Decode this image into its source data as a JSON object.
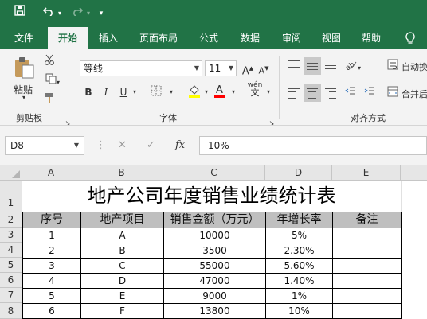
{
  "quick_access": {
    "more_label": "▾"
  },
  "tabs": [
    "文件",
    "开始",
    "插入",
    "页面布局",
    "公式",
    "数据",
    "审阅",
    "视图",
    "帮助"
  ],
  "ribbon": {
    "paste_label": "粘贴",
    "clipboard_group": "剪贴板",
    "font_name": "等线",
    "font_size": "11",
    "font_group": "字体",
    "bold": "B",
    "italic": "I",
    "underline": "U",
    "phonetic": "wén",
    "wrap_text": "自动换",
    "merge_center": "合并后",
    "align_group": "对齐方式"
  },
  "formula_bar": {
    "name_box": "D8",
    "fx": "fx",
    "value": "10%"
  },
  "sheet": {
    "columns": [
      "A",
      "B",
      "C",
      "D",
      "E"
    ],
    "rows": [
      "1",
      "2",
      "3",
      "4",
      "5",
      "6",
      "7",
      "8"
    ],
    "title": "地产公司年度销售业绩统计表",
    "headers": [
      "序号",
      "地产项目",
      "销售金额（万元）",
      "年增长率",
      "备注"
    ],
    "data": [
      [
        "1",
        "A",
        "10000",
        "5%",
        ""
      ],
      [
        "2",
        "B",
        "3500",
        "2.30%",
        ""
      ],
      [
        "3",
        "C",
        "55000",
        "5.60%",
        ""
      ],
      [
        "4",
        "D",
        "47000",
        "1.40%",
        ""
      ],
      [
        "5",
        "E",
        "9000",
        "1%",
        ""
      ],
      [
        "6",
        "F",
        "13800",
        "10%",
        ""
      ]
    ]
  },
  "colors": {
    "excel_green": "#217346",
    "header_fill": "#bfbfbf"
  }
}
